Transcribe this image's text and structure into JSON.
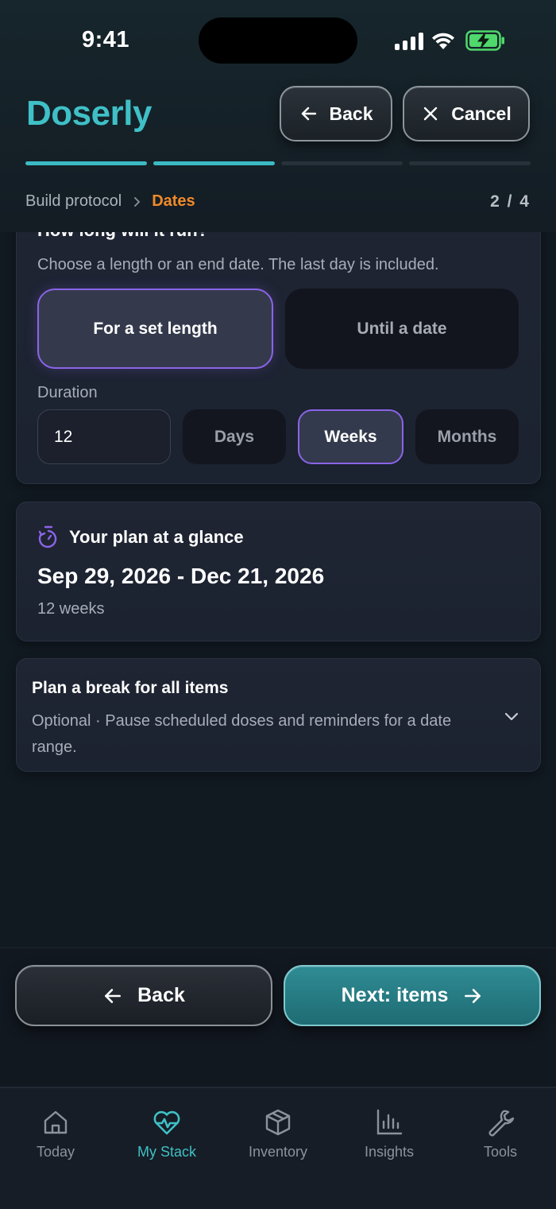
{
  "status_bar": {
    "time": "9:41"
  },
  "header": {
    "brand": "Doserly",
    "back_label": "Back",
    "cancel_label": "Cancel",
    "progress_steps_total": 4,
    "progress_steps_done": 2,
    "breadcrumb": {
      "parent": "Build protocol",
      "current": "Dates"
    },
    "step_counter": "2 / 4"
  },
  "duration_card": {
    "title": "How long will it run?",
    "hint": "Choose a length or an end date. The last day is included.",
    "options": [
      {
        "label": "For a set length",
        "selected": true
      },
      {
        "label": "Until a date",
        "selected": false
      }
    ],
    "duration_label": "Duration",
    "duration_value": "12",
    "units": [
      {
        "label": "Days",
        "selected": false
      },
      {
        "label": "Weeks",
        "selected": true
      },
      {
        "label": "Months",
        "selected": false
      }
    ]
  },
  "glance_card": {
    "title": "Your plan at a glance",
    "date_range": "Sep 29, 2026 - Dec 21, 2026",
    "length": "12 weeks"
  },
  "break_card": {
    "title": "Plan a break for all items",
    "description": "Optional · Pause scheduled doses and reminders for a date range."
  },
  "actions": {
    "back_label": "Back",
    "next_label": "Next: items"
  },
  "tab_bar": {
    "tabs": [
      {
        "label": "Today",
        "icon": "home-icon",
        "active": false
      },
      {
        "label": "My Stack",
        "icon": "heart-pulse-icon",
        "active": true
      },
      {
        "label": "Inventory",
        "icon": "box-icon",
        "active": false
      },
      {
        "label": "Insights",
        "icon": "bar-chart-icon",
        "active": false
      },
      {
        "label": "Tools",
        "icon": "wrench-icon",
        "active": false
      }
    ]
  },
  "colors": {
    "brand_teal": "#3fc0c6",
    "accent_purple": "#8b64e8",
    "breadcrumb_orange": "#f08a2a",
    "background": "#111921"
  }
}
